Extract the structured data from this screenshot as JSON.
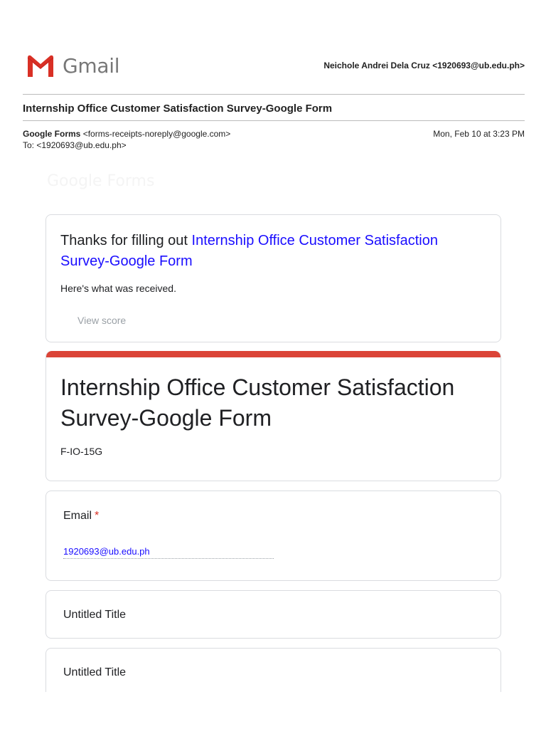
{
  "header": {
    "brand": "Gmail",
    "recipient": "Neichole Andrei Dela Cruz <1920693@ub.edu.ph>"
  },
  "email": {
    "subject": "Internship Office Customer Satisfaction Survey-Google Form",
    "from_name": "Google Forms",
    "from_address": "<forms-receipts-noreply@google.com>",
    "to": "To: <1920693@ub.edu.ph>",
    "date": "Mon, Feb 10 at 3:23 PM"
  },
  "receipt": {
    "ghost_logo": "Google Forms",
    "thanks_prefix": "Thanks for filling out ",
    "form_link": "Internship Office Customer Satisfaction Survey-Google Form",
    "received_text": "Here's what was received.",
    "view_score": "View score"
  },
  "form": {
    "title": "Internship Office Customer Satisfaction Survey-Google Form",
    "description": "F-IO-15G",
    "accent_color": "#db4437",
    "questions": [
      {
        "label": "Email",
        "required_mark": "*",
        "answer": "1920693@ub.edu.ph"
      },
      {
        "label": "Untitled Title"
      },
      {
        "label": "Untitled Title"
      }
    ]
  }
}
